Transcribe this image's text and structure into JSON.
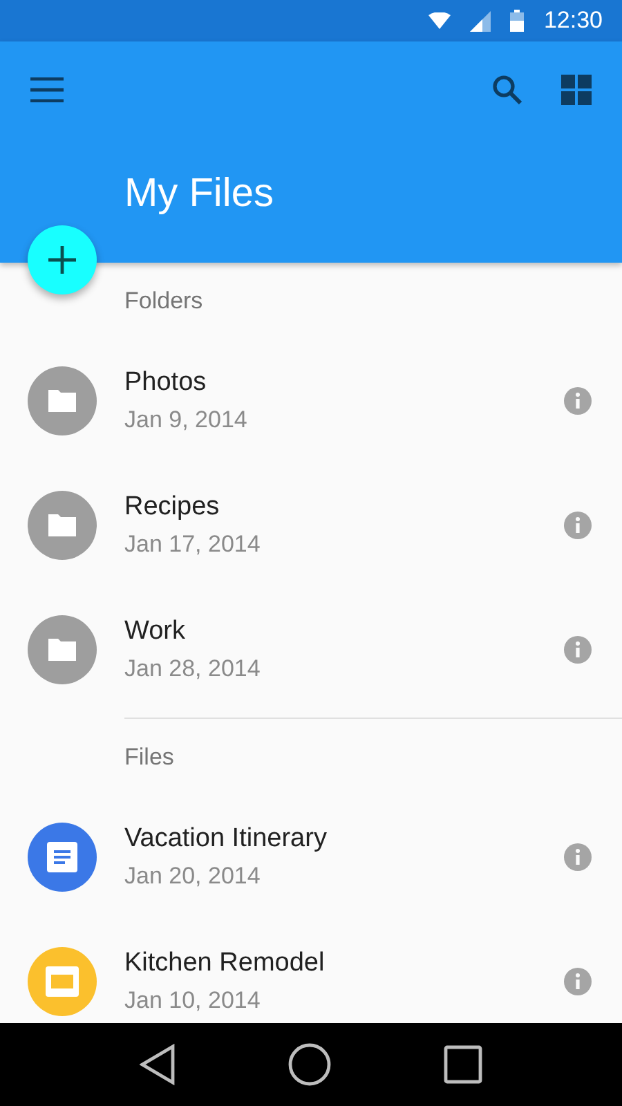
{
  "status_bar": {
    "time": "12:30"
  },
  "app_bar": {
    "title": "My Files"
  },
  "sections": [
    {
      "title": "Folders",
      "items": [
        {
          "name": "Photos",
          "date": "Jan 9, 2014",
          "kind": "folder",
          "color": "#9e9e9e"
        },
        {
          "name": "Recipes",
          "date": "Jan 17, 2014",
          "kind": "folder",
          "color": "#9e9e9e"
        },
        {
          "name": "Work",
          "date": "Jan 28, 2014",
          "kind": "folder",
          "color": "#9e9e9e"
        }
      ]
    },
    {
      "title": "Files",
      "items": [
        {
          "name": "Vacation Itinerary",
          "date": "Jan 20, 2014",
          "kind": "document",
          "color": "#3b78e7"
        },
        {
          "name": "Kitchen Remodel",
          "date": "Jan 10, 2014",
          "kind": "slides",
          "color": "#fbc02d"
        }
      ]
    }
  ]
}
